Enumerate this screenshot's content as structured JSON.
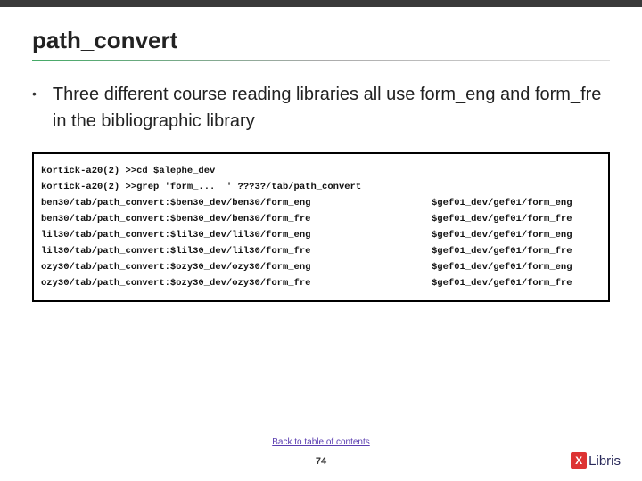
{
  "title": "path_convert",
  "bullet": "Three different course reading libraries all use form_eng and form_fre in the bibliographic library",
  "code": {
    "cmd1": "kortick-a20(2) >>cd $alephe_dev",
    "cmd2": "kortick-a20(2) >>grep 'form_...  ' ???3?/tab/path_convert",
    "rows": [
      {
        "left": "ben30/tab/path_convert:$ben30_dev/ben30/form_eng",
        "right": "$gef01_dev/gef01/form_eng"
      },
      {
        "left": "ben30/tab/path_convert:$ben30_dev/ben30/form_fre",
        "right": "$gef01_dev/gef01/form_fre"
      },
      {
        "left": "lil30/tab/path_convert:$lil30_dev/lil30/form_eng",
        "right": "$gef01_dev/gef01/form_eng"
      },
      {
        "left": "lil30/tab/path_convert:$lil30_dev/lil30/form_fre",
        "right": "$gef01_dev/gef01/form_fre"
      },
      {
        "left": "ozy30/tab/path_convert:$ozy30_dev/ozy30/form_eng",
        "right": "$gef01_dev/gef01/form_eng"
      },
      {
        "left": "ozy30/tab/path_convert:$ozy30_dev/ozy30/form_fre",
        "right": "$gef01_dev/gef01/form_fre"
      }
    ]
  },
  "back_link": "Back to table of contents",
  "page_num": "74",
  "logo": {
    "x": "X",
    "text": "Libris"
  }
}
